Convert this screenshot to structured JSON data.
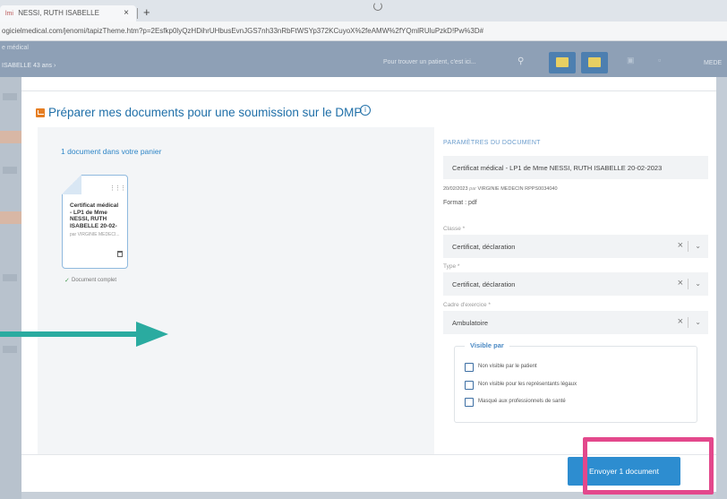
{
  "browser": {
    "tab_favicon": "lmi",
    "tab_title": "NESSI, RUTH ISABELLE",
    "tab_close": "×",
    "new_tab": "+",
    "url": "ogicielmedical.com/jenomi/tapizTheme.htm?p=2Esfkp0lyQzHDihrUHbusEvnJGS7nh33nRbFtWSYp372KCuyoX%2feAMW%2fYQmlRUluPzkD!Pw%3D#"
  },
  "app": {
    "crumb1": "e médical",
    "crumb2": "ISABELLE 43 ans ›",
    "search_placeholder": "Pour trouver un patient, c'est ici...",
    "right_label": "MEDE",
    "accent_color": "#4d7fb0"
  },
  "modal": {
    "title": "Préparer mes documents pour une soumission sur le DMP",
    "info_symbol": "i",
    "basket_label": "1 document dans votre panier",
    "document_card": {
      "title": "Certificat médical - LP1 de Mme NESSI, RUTH ISABELLE 20-02-",
      "author": "par VIRGINIE MEDECI...",
      "status": "Document complet"
    },
    "params": {
      "section_title": "PARAMÈTRES DU DOCUMENT",
      "document_name": "Certificat médical - LP1 de Mme NESSI, RUTH ISABELLE 20-02-2023",
      "meta_date": "20/02/2023",
      "meta_by": "par",
      "meta_author": "VIRGINIE MEDECIN RPPS0034040",
      "format": "Format : pdf",
      "classe_label": "Classe *",
      "classe_value": "Certificat, déclaration",
      "type_label": "Type *",
      "type_value": "Certificat, déclaration",
      "cadre_label": "Cadre d'exercice *",
      "cadre_value": "Ambulatoire",
      "visible_legend": "Visible par",
      "visibility_options": [
        "Non visible par le patient",
        "Non visible pour les représentants légaux",
        "Masqué aux professionnels de santé"
      ]
    },
    "send_button": "Envoyer 1 document"
  },
  "colors": {
    "title_blue": "#1f6fa8",
    "button_blue": "#2d8dd0",
    "annotation_pink": "#e3488c",
    "annotation_teal": "#2aaba0"
  }
}
